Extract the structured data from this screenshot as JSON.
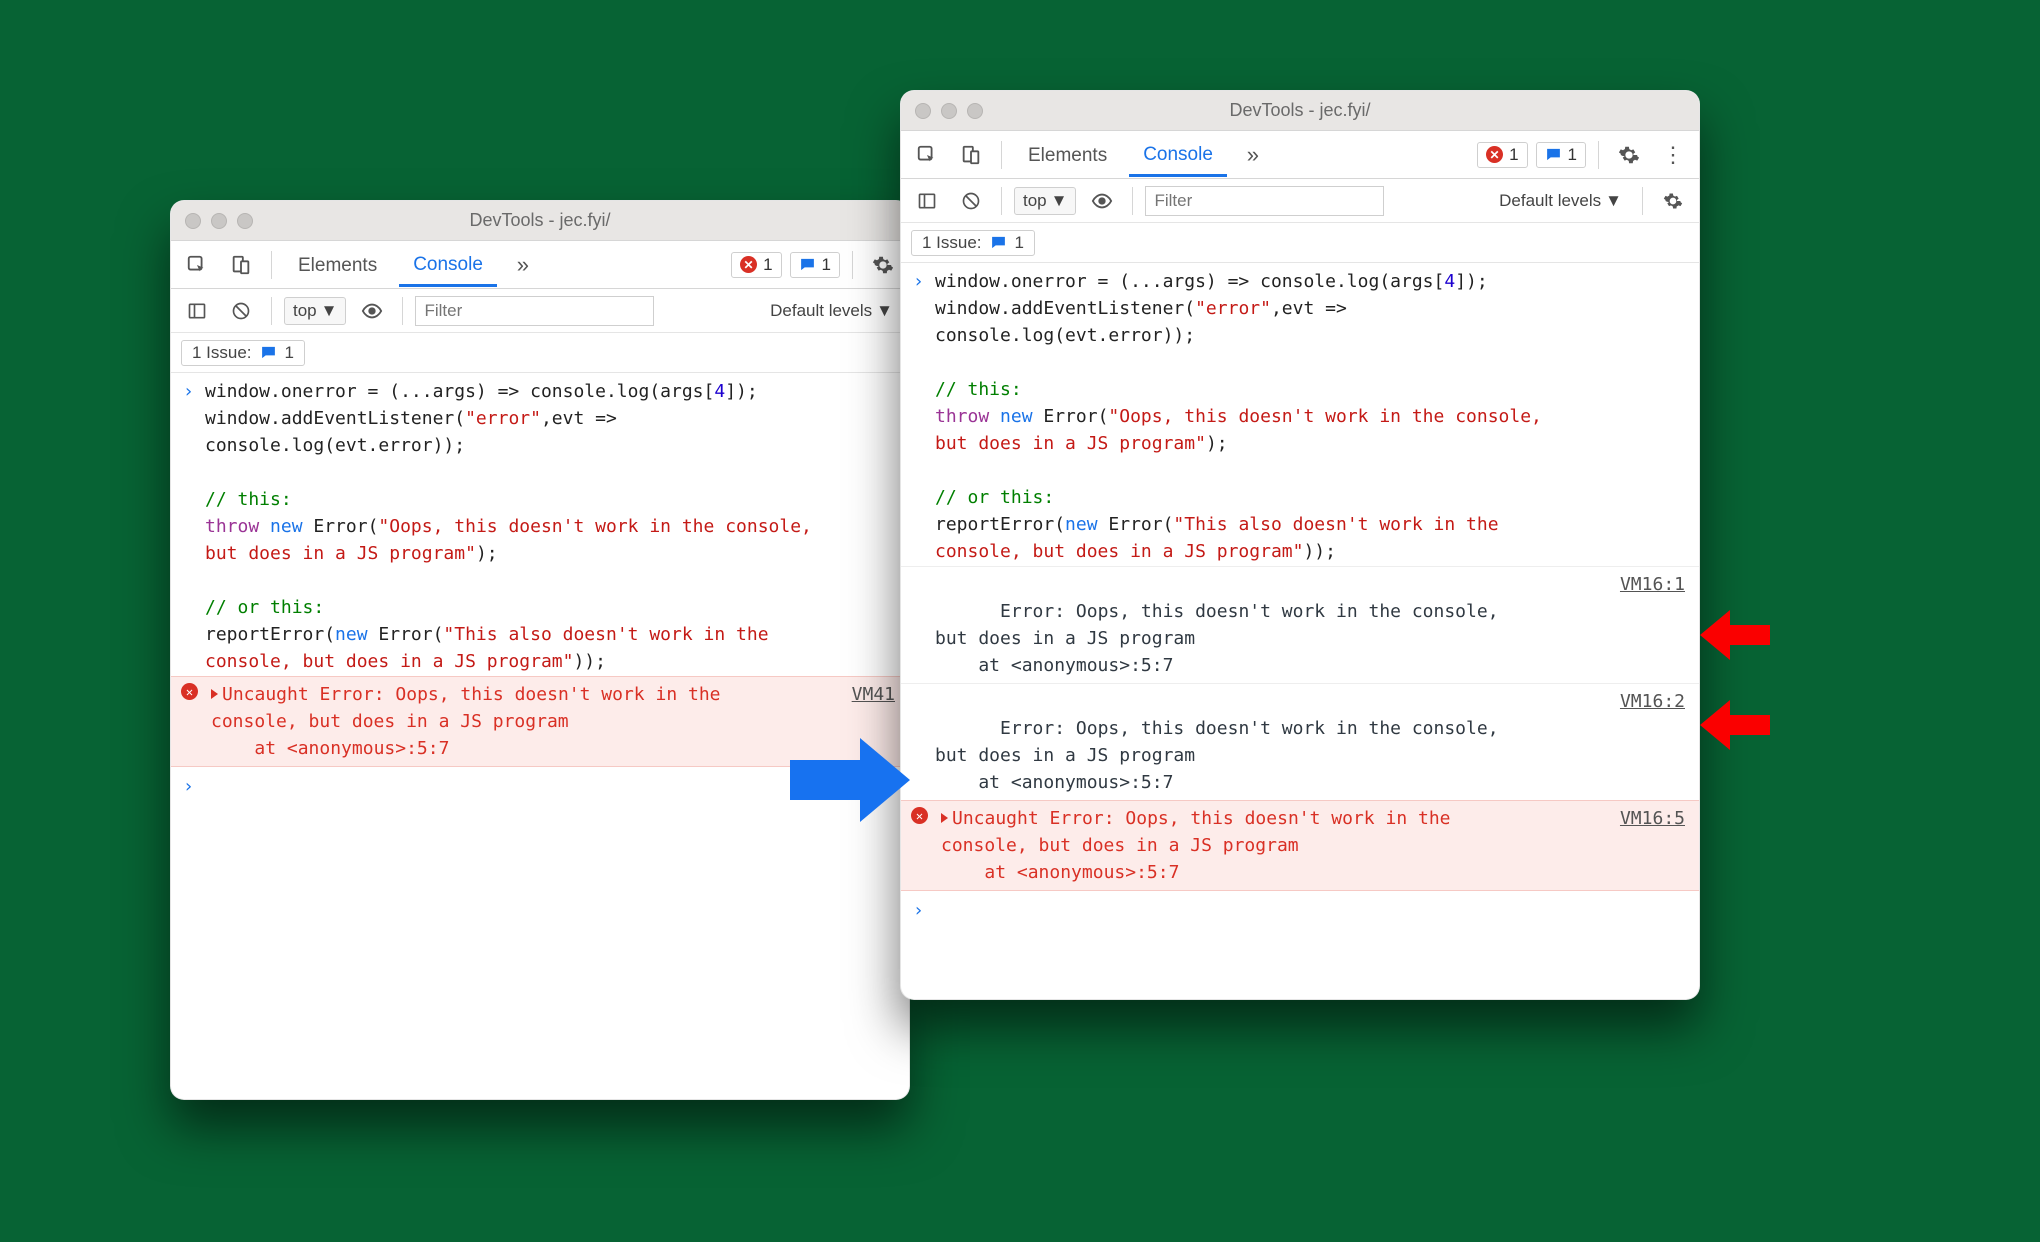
{
  "windowTitle": "DevTools - jec.fyi/",
  "tabs": {
    "elements": "Elements",
    "console": "Console"
  },
  "badges": {
    "errCount": "1",
    "msgCount": "1"
  },
  "toolbar": {
    "context": "top",
    "filterPlaceholder": "Filter",
    "levels": "Default levels"
  },
  "issues": {
    "label": "1 Issue:",
    "count": "1"
  },
  "code": {
    "l1a": "window.onerror = (...args) => console.log(args[",
    "l1num": "4",
    "l1b": "]);",
    "l2a": "window.addEventListener(",
    "l2s": "\"error\"",
    "l2b": ",evt =>",
    "l3": "console.log(evt.error));",
    "c1": "// this:",
    "t1a": "throw",
    "t1b": "new",
    "t1c": " Error(",
    "t1s": "\"Oops, this doesn't work in the console,",
    "t2s": "but does in a JS program\"",
    "t2b": ");",
    "c2": "// or this:",
    "r1a": "reportError(",
    "r1b": "new",
    "r1c": " Error(",
    "r1s": "\"This also doesn't work in the",
    "r2s": "console, but does in a JS program\"",
    "r2b": "));"
  },
  "left": {
    "errLine1": "Uncaught Error: Oops, this doesn't work in the",
    "errLine2": "console, but does in a JS program",
    "errLine3": "    at <anonymous>:5:7",
    "errSrc": "VM41"
  },
  "right": {
    "log1l1": "Error: Oops, this doesn't work in the console,",
    "log1l2": "but does in a JS program",
    "log1l3": "    at <anonymous>:5:7",
    "log1src": "VM16:1",
    "log2src": "VM16:2",
    "errSrc": "VM16:5"
  }
}
